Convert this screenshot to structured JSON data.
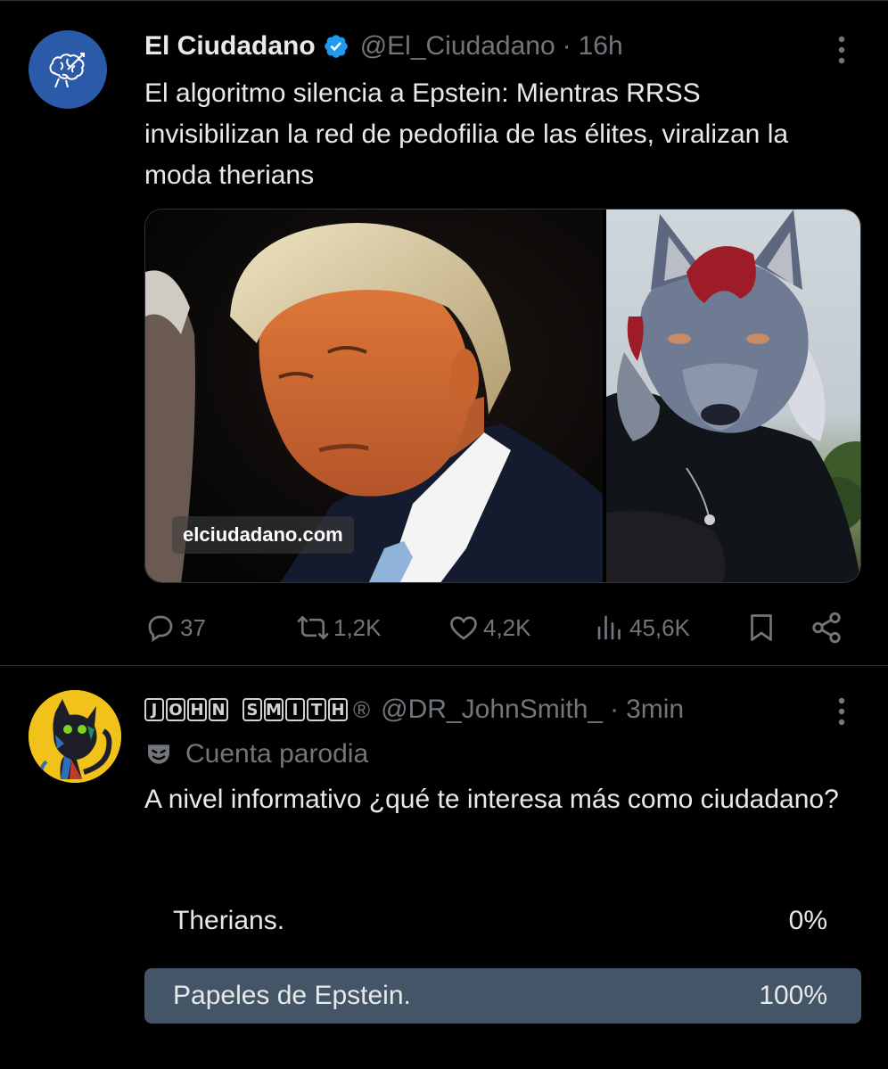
{
  "tweet1": {
    "name": "El Ciudadano",
    "handle": "@El_Ciudadano",
    "separator": "·",
    "time": "16h",
    "text": "El algoritmo silencia a Epstein: Mientras RRSS invisibilizan la red de pedofilia de las élites, viralizan la moda therians",
    "media_watermark": "elciudadano.com",
    "actions": {
      "replies": "37",
      "reposts": "1,2K",
      "likes": "4,2K",
      "views": "45,6K"
    }
  },
  "tweet2": {
    "name_boxed": [
      "J",
      "O",
      "H",
      "N",
      " ",
      "S",
      "M",
      "I",
      "T",
      "H"
    ],
    "registered": "®",
    "handle": "@DR_JohnSmith_",
    "separator": "·",
    "time": "3min",
    "parody_label": "Cuenta parodia",
    "text": "A nivel informativo ¿qué te interesa más como ciudadano?",
    "poll": [
      {
        "label": "Therians.",
        "percent": "0%",
        "share": 0
      },
      {
        "label": "Papeles de Epstein.",
        "percent": "100%",
        "share": 1
      }
    ]
  },
  "colors": {
    "background": "#000000",
    "text": "#e7e9ea",
    "muted": "#71767b",
    "verified": "#1d9bf0",
    "poll_winner": "#435566",
    "avatar1_bg": "#2a5aa8",
    "avatar2_bg": "#f1c21a"
  },
  "icons": {
    "verified": "verified-badge-icon",
    "more": "more-vertical-icon",
    "reply": "reply-icon",
    "repost": "repost-icon",
    "like": "heart-icon",
    "views": "views-bar-chart-icon",
    "bookmark": "bookmark-icon",
    "share": "share-icon",
    "parody": "theater-mask-icon"
  }
}
